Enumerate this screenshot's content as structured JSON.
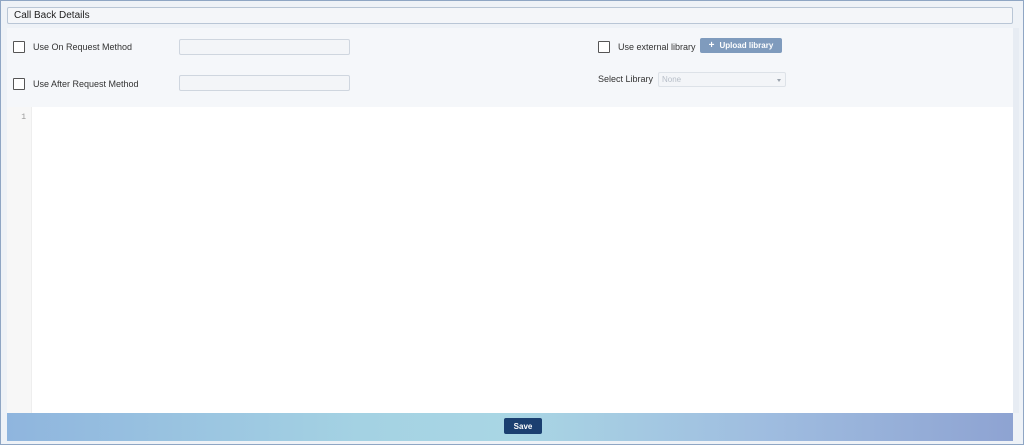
{
  "header": {
    "title": "Call Back Details"
  },
  "callbacks": {
    "on_request": {
      "label": "Use On Request Method",
      "value": ""
    },
    "after_request": {
      "label": "Use After Request Method",
      "value": ""
    }
  },
  "library": {
    "use_external_label": "Use external library",
    "upload_label": "Upload library",
    "upload_icon": "+",
    "select_label": "Select Library",
    "select_value": "None"
  },
  "editor": {
    "line_numbers": [
      "1"
    ]
  },
  "footer": {
    "save_label": "Save"
  }
}
